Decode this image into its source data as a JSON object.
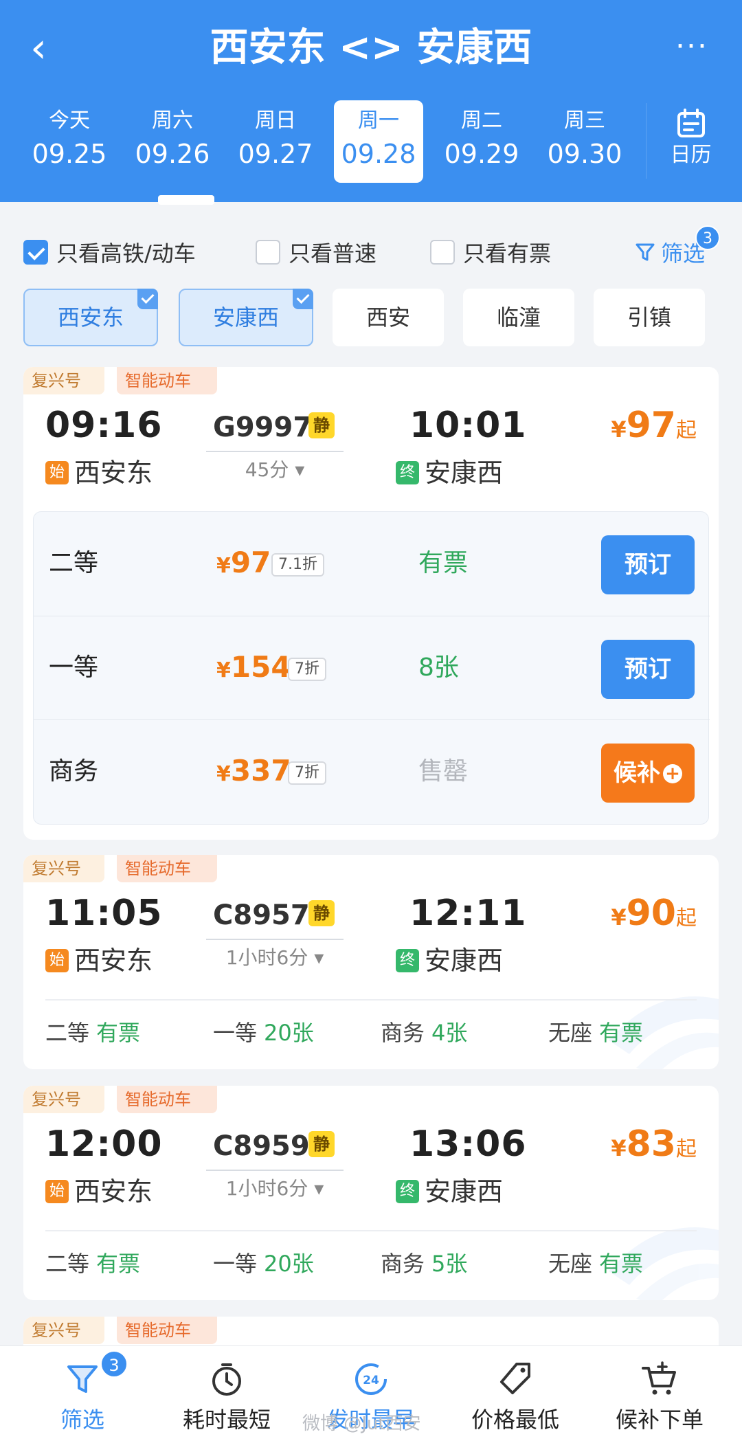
{
  "header": {
    "back": "‹",
    "title": "西安东 <> 安康西",
    "more": "···"
  },
  "dates": [
    {
      "weekday": "今天",
      "date": "09.25",
      "active": false
    },
    {
      "weekday": "周六",
      "date": "09.26",
      "active": false
    },
    {
      "weekday": "周日",
      "date": "09.27",
      "active": false
    },
    {
      "weekday": "周一",
      "date": "09.28",
      "active": true
    },
    {
      "weekday": "周二",
      "date": "09.29",
      "active": false
    },
    {
      "weekday": "周三",
      "date": "09.30",
      "active": false
    }
  ],
  "calendar": {
    "label": "日历"
  },
  "filters": {
    "high_speed_only": {
      "label": "只看高铁/动车",
      "checked": true
    },
    "normal_only": {
      "label": "只看普速",
      "checked": false
    },
    "available_only": {
      "label": "只看有票",
      "checked": false
    },
    "screen": {
      "label": "筛选",
      "badge": "3"
    }
  },
  "stations": [
    {
      "name": "西安东",
      "selected": true
    },
    {
      "name": "安康西",
      "selected": true
    },
    {
      "name": "西安",
      "selected": false
    },
    {
      "name": "临潼",
      "selected": false
    },
    {
      "name": "引镇",
      "selected": false
    }
  ],
  "trains": [
    {
      "tags": [
        "复兴号",
        "智能动车"
      ],
      "dep_time": "09:16",
      "train_no": "G9997",
      "quiet": "静",
      "arr_time": "10:01",
      "duration": "45分 ▾",
      "price_cur": "¥",
      "price": "97",
      "price_suffix": "起",
      "dep_mark": "始",
      "dep_station": "西安东",
      "arr_mark": "终",
      "arr_station": "安康西",
      "seats": [
        {
          "name": "二等",
          "cur": "¥",
          "price": "97",
          "discount": "7.1折",
          "avail": "有票",
          "sold": false,
          "action": "预订",
          "wait": false
        },
        {
          "name": "一等",
          "cur": "¥",
          "price": "154",
          "discount": "7折",
          "avail": "8张",
          "sold": false,
          "action": "预订",
          "wait": false
        },
        {
          "name": "商务",
          "cur": "¥",
          "price": "337",
          "discount": "7折",
          "avail": "售罄",
          "sold": true,
          "action": "候补",
          "wait": true
        }
      ]
    },
    {
      "tags": [
        "复兴号",
        "智能动车"
      ],
      "dep_time": "11:05",
      "train_no": "C8957",
      "quiet": "静",
      "arr_time": "12:11",
      "duration": "1小时6分 ▾",
      "price_cur": "¥",
      "price": "90",
      "price_suffix": "起",
      "dep_mark": "始",
      "dep_station": "西安东",
      "arr_mark": "终",
      "arr_station": "安康西",
      "summary": [
        {
          "name": "二等",
          "value": "有票"
        },
        {
          "name": "一等",
          "value": "20张"
        },
        {
          "name": "商务",
          "value": "4张"
        },
        {
          "name": "无座",
          "value": "有票"
        }
      ]
    },
    {
      "tags": [
        "复兴号",
        "智能动车"
      ],
      "dep_time": "12:00",
      "train_no": "C8959",
      "quiet": "静",
      "arr_time": "13:06",
      "duration": "1小时6分 ▾",
      "price_cur": "¥",
      "price": "83",
      "price_suffix": "起",
      "dep_mark": "始",
      "dep_station": "西安东",
      "arr_mark": "终",
      "arr_station": "安康西",
      "summary": [
        {
          "name": "二等",
          "value": "有票"
        },
        {
          "name": "一等",
          "value": "20张"
        },
        {
          "name": "商务",
          "value": "5张"
        },
        {
          "name": "无座",
          "value": "有票"
        }
      ]
    },
    {
      "tags": [
        "复兴号",
        "智能动车"
      ]
    }
  ],
  "bottom_nav": [
    {
      "label": "筛选",
      "icon": "filter-icon",
      "badge": "3",
      "active": true
    },
    {
      "label": "耗时最短",
      "icon": "stopwatch-icon",
      "active": false
    },
    {
      "label": "发时最早",
      "icon": "clock-24-icon",
      "active": true
    },
    {
      "label": "价格最低",
      "icon": "price-tag-icon",
      "active": false
    },
    {
      "label": "候补下单",
      "icon": "cart-plus-icon",
      "active": false
    }
  ],
  "watermark": "微博 @Jut西安",
  "colors": {
    "primary": "#3b8ff0",
    "price": "#f07b16",
    "available": "#30a85c",
    "wait": "#f5791b"
  }
}
